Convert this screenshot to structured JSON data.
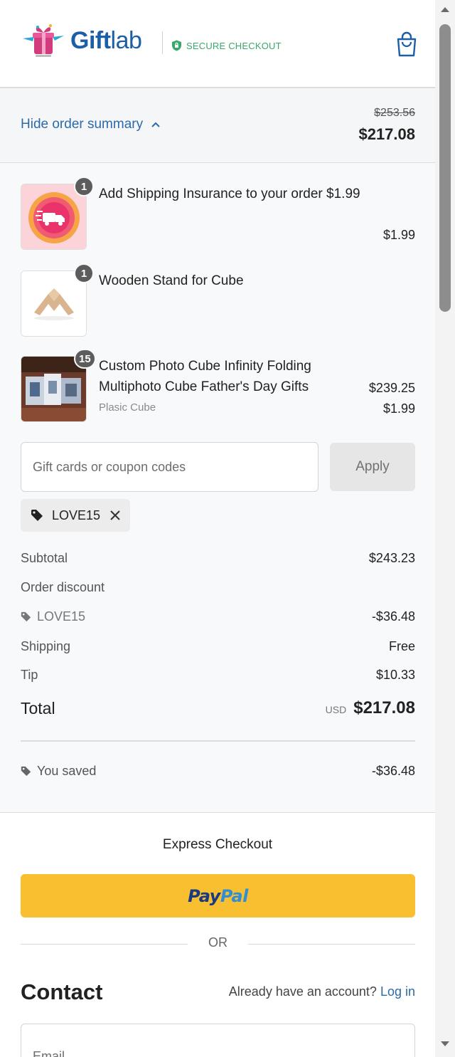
{
  "header": {
    "brand_bold": "Gift",
    "brand_light": "lab",
    "secure_label": "SECURE CHECKOUT",
    "icons": {
      "logo": "giftbox-logo-icon",
      "secure": "shield-icon",
      "cart": "shopping-bag-icon"
    }
  },
  "summary_bar": {
    "toggle_label": "Hide order summary",
    "original_price": "$253.56",
    "price": "$217.08"
  },
  "items": [
    {
      "qty": "1",
      "name": "Add Shipping Insurance to your order $1.99",
      "price": "$1.99",
      "thumb": "shipping-insurance-badge"
    },
    {
      "qty": "1",
      "name": "Wooden Stand for Cube",
      "price": "$1.99",
      "thumb": "wooden-stand"
    },
    {
      "qty": "15",
      "name": "Custom Photo Cube Infinity Folding Multiphoto Cube Father's Day Gifts",
      "variant": "Plasic Cube",
      "price": "$239.25",
      "thumb": "photo-cube"
    }
  ],
  "coupon": {
    "placeholder": "Gift cards or coupon codes",
    "apply_label": "Apply",
    "applied_code": "LOVE15"
  },
  "totals": {
    "subtotal_label": "Subtotal",
    "subtotal": "$243.23",
    "discount_label": "Order discount",
    "discount_code": "LOVE15",
    "discount_amount": "-$36.48",
    "shipping_label": "Shipping",
    "shipping": "Free",
    "tip_label": "Tip",
    "tip": "$10.33",
    "total_label": "Total",
    "currency": "USD",
    "total": "$217.08",
    "saved_label": "You saved",
    "saved": "-$36.48"
  },
  "express": {
    "title": "Express Checkout",
    "paypal_pay": "Pay",
    "paypal_pal": "Pal",
    "or_label": "OR"
  },
  "contact": {
    "heading": "Contact",
    "account_prompt": "Already have an account?",
    "login_label": "Log in",
    "email_placeholder": "Email"
  },
  "colors": {
    "brand_blue": "#1d5fa6",
    "secure_green": "#39a86a",
    "link_blue": "#2c6aa8",
    "paypal_yellow": "#f8bf30"
  }
}
